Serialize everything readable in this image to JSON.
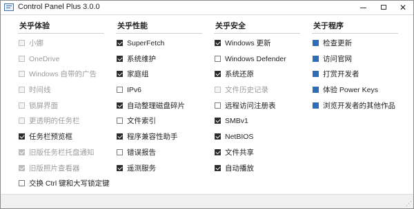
{
  "window": {
    "title": "Control Panel Plus 3.0.0",
    "minimize_glyph": "",
    "close_glyph": "✕"
  },
  "columns": [
    {
      "title": "关乎体验",
      "items": [
        {
          "label": "小娜",
          "checked": false,
          "disabled": true
        },
        {
          "label": "OneDrive",
          "checked": false,
          "disabled": true
        },
        {
          "label": "Windows 自带的广告",
          "checked": false,
          "disabled": true
        },
        {
          "label": "时间线",
          "checked": false,
          "disabled": true
        },
        {
          "label": "锁屏界面",
          "checked": false,
          "disabled": true
        },
        {
          "label": "更透明的任务栏",
          "checked": false,
          "disabled": true
        },
        {
          "label": "任务栏预览框",
          "checked": true,
          "disabled": false
        },
        {
          "label": "旧版任务栏托盘通知",
          "checked": true,
          "disabled": true
        },
        {
          "label": "旧版照片查看器",
          "checked": true,
          "disabled": true
        },
        {
          "label": "交换 Ctrl 键和大写锁定键",
          "checked": false,
          "disabled": false
        }
      ]
    },
    {
      "title": "关乎性能",
      "items": [
        {
          "label": "SuperFetch",
          "checked": true,
          "disabled": false
        },
        {
          "label": "系统维护",
          "checked": true,
          "disabled": false
        },
        {
          "label": "家庭组",
          "checked": true,
          "disabled": false
        },
        {
          "label": "IPv6",
          "checked": false,
          "disabled": false
        },
        {
          "label": "自动整理磁盘碎片",
          "checked": true,
          "disabled": false
        },
        {
          "label": "文件索引",
          "checked": false,
          "disabled": false
        },
        {
          "label": "程序兼容性助手",
          "checked": true,
          "disabled": false
        },
        {
          "label": "错误报告",
          "checked": false,
          "disabled": false
        },
        {
          "label": "遥测服务",
          "checked": true,
          "disabled": false
        }
      ]
    },
    {
      "title": "关乎安全",
      "items": [
        {
          "label": "Windows 更新",
          "checked": true,
          "disabled": false
        },
        {
          "label": "Windows Defender",
          "checked": false,
          "disabled": false
        },
        {
          "label": "系统还原",
          "checked": true,
          "disabled": false
        },
        {
          "label": "文件历史记录",
          "checked": false,
          "disabled": true
        },
        {
          "label": "远程访问注册表",
          "checked": false,
          "disabled": false
        },
        {
          "label": "SMBv1",
          "checked": true,
          "disabled": false
        },
        {
          "label": "NetBIOS",
          "checked": true,
          "disabled": false
        },
        {
          "label": "文件共享",
          "checked": true,
          "disabled": false
        },
        {
          "label": "自动播放",
          "checked": true,
          "disabled": false
        }
      ]
    },
    {
      "title": "关于程序",
      "items": [
        {
          "label": "检查更新",
          "square": true
        },
        {
          "label": "访问官网",
          "square": true
        },
        {
          "label": "打赏开发者",
          "square": true
        },
        {
          "label": "体验 Power Keys",
          "square": true
        },
        {
          "label": "浏览开发者的其他作品",
          "square": true
        }
      ]
    }
  ]
}
